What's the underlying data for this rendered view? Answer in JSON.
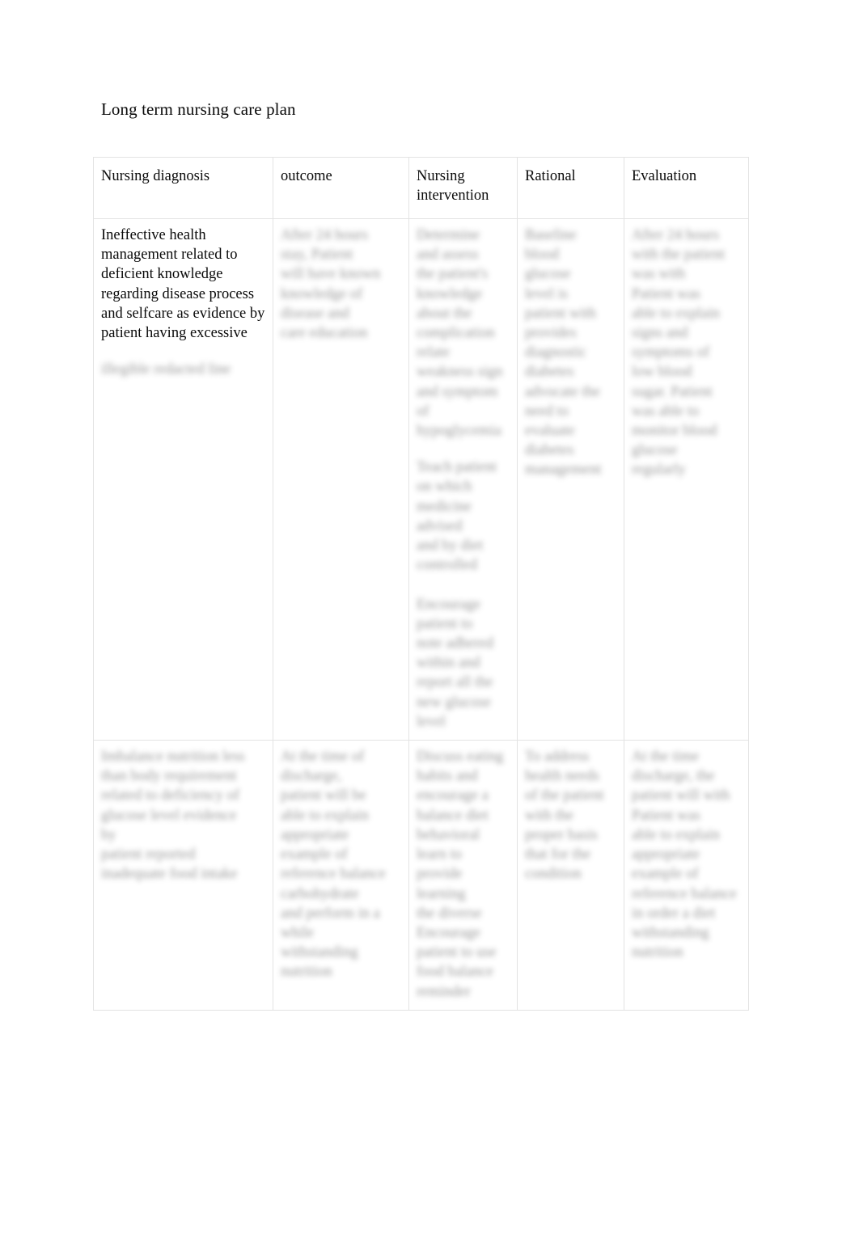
{
  "document": {
    "title": "Long term nursing care plan"
  },
  "table": {
    "headers": [
      {
        "key": "diagnosis",
        "label": "Nursing diagnosis"
      },
      {
        "key": "outcome",
        "label": "outcome"
      },
      {
        "key": "intervention",
        "label": "Nursing intervention"
      },
      {
        "key": "rational",
        "label": "Rational"
      },
      {
        "key": "evaluation",
        "label": "Evaluation"
      }
    ],
    "rows": [
      {
        "diagnosis": {
          "legible": "Ineffective health management related to deficient knowledge regarding disease process and selfcare as evidence by patient having excessive",
          "redacted": "illegible redacted line"
        },
        "outcome": {
          "legible": "",
          "redacted": "After 24 hours\nstay, Patient\nwill have known\nknowledge of\ndisease and\ncare education"
        },
        "intervention": {
          "legible": "",
          "redacted": "Determine\nand assess\nthe patient's\nknowledge\nabout the\ncomplication\nrelate\nweakness sign\nand symptom of\nhypoglycemia",
          "redacted_2": "Teach patient\non which\nmedicine\nadvised\nand by diet\ncontrolled\n\nEncourage\npatient to\nnote adhered\nwithin and\nreport all the\nnew glucose\nlevel"
        },
        "rational": {
          "legible": "",
          "redacted": "Baseline\nblood\nglucose\nlevel is\npatient with\nprovides\ndiagnostic\ndiabetes\nadvocate the\nneed to\nevaluate\ndiabetes\nmanagement"
        },
        "evaluation": {
          "legible": "",
          "redacted": "After 24 hours\nwith the patient\nwas with\nPatient was\nable to explain\nsigns and\nsymptoms of\nlow blood\nsugar. Patient\nwas able to\nmonitor blood\nglucose\nregularly"
        }
      },
      {
        "diagnosis": {
          "legible": "",
          "redacted": "Imbalance nutrition less\nthan body requirement\nrelated to deficiency of\nglucose level evidence\nby\npatient reported\ninadequate food intake"
        },
        "outcome": {
          "legible": "",
          "redacted": "At the time of\ndischarge,\npatient will be\nable to explain\nappropriate\nexample of\nreference balance\n   carbohydrate\nand perform in a\nwhile\nwithstanding\nnutrition"
        },
        "intervention": {
          "legible": "",
          "redacted": "Discuss eating\nhabits and\nencourage a\nbalance diet\nbehavioral\nlearn to\nprovide learning\nthe diverse\nEncourage\npatient to use\nfood balance\nreminder"
        },
        "rational": {
          "legible": "",
          "redacted": "To address\nhealth needs\nof the patient\nwith the\nproper basis\nthat for the\ncondition"
        },
        "evaluation": {
          "legible": "",
          "redacted": "At the time\ndischarge, the\npatient will with\nPatient was\nable to explain\nappropriate\nexample of\nreference balance\n   in order a diet\nwithstanding\nnutrition"
        }
      }
    ]
  }
}
